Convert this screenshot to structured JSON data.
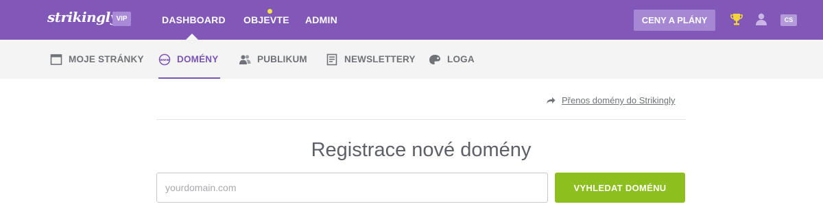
{
  "topbar": {
    "logo": "strikingly",
    "badge": "VIP",
    "nav": [
      {
        "label": "DASHBOARD"
      },
      {
        "label": "OBJEVTE"
      },
      {
        "label": "ADMIN"
      }
    ],
    "pricing_label": "CENY A PLÁNY",
    "language": "CS",
    "colors": {
      "background": "#8158b8",
      "notification_dot": "#f2e143"
    }
  },
  "subnav": {
    "items": [
      {
        "label": "MOJE STRÁNKY",
        "icon": "browser-window-icon"
      },
      {
        "label": "DOMÉNY",
        "icon": "www-icon",
        "active": true
      },
      {
        "label": "PUBLIKUM",
        "icon": "people-icon"
      },
      {
        "label": "NEWSLETTERY",
        "icon": "newsletter-icon"
      },
      {
        "label": "LOGA",
        "icon": "palette-icon"
      }
    ],
    "active_color": "#7a54b6"
  },
  "main": {
    "transfer_link": "Přenos domény do Strikingly",
    "heading": "Registrace nové domény",
    "domain_input": {
      "placeholder": "yourdomain.com",
      "value": ""
    },
    "search_button": "VYHLEDAT DOMÉNU",
    "button_color": "#8dbf1e"
  }
}
